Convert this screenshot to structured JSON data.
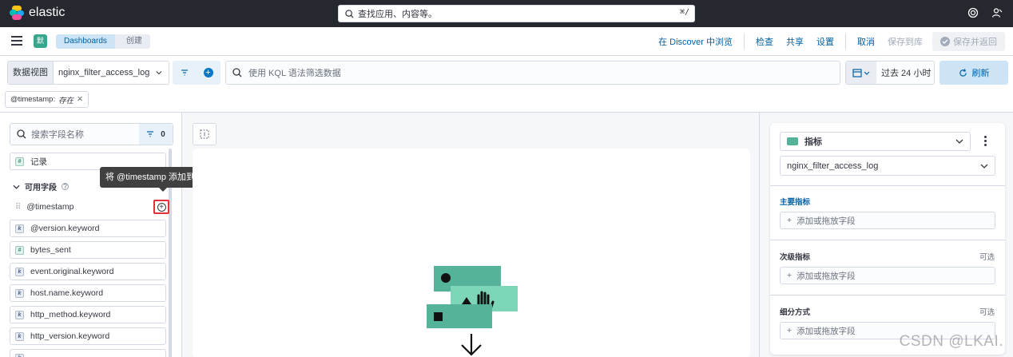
{
  "topbar": {
    "brand": "elastic",
    "search_placeholder": "查找应用、内容等。",
    "search_shortcut": "⌘/",
    "icons": [
      "help-icon",
      "user-icon"
    ]
  },
  "header": {
    "space_initial": "默",
    "breadcrumbs": [
      "Dashboards",
      "创建"
    ],
    "links": [
      "在 Discover 中浏览",
      "检查",
      "共享",
      "设置"
    ],
    "cancel": "取消",
    "save_to_library": "保存到库",
    "save_and_return": "保存并返回"
  },
  "querybar": {
    "dataview_label": "数据视图",
    "dataview_value": "nginx_filter_access_log",
    "kql_placeholder": "使用 KQL 语法筛选数据",
    "time_range": "过去 24 小时",
    "refresh": "刷新"
  },
  "filter_pill": {
    "field": "@timestamp:",
    "value": "存在"
  },
  "sidebar": {
    "search_placeholder": "搜索字段名称",
    "filter_count": "0",
    "records_label": "记录",
    "section_title": "可用字段",
    "tooltip": "将 @timestamp 添加到工作区",
    "fields": [
      {
        "name": "@timestamp",
        "type": "date"
      },
      {
        "name": "@version.keyword",
        "type": "k"
      },
      {
        "name": "bytes_sent",
        "type": "#"
      },
      {
        "name": "event.original.keyword",
        "type": "k"
      },
      {
        "name": "host.name.keyword",
        "type": "k"
      },
      {
        "name": "http_method.keyword",
        "type": "k"
      },
      {
        "name": "http_version.keyword",
        "type": "k"
      }
    ]
  },
  "config": {
    "vis_type": "指标",
    "dataview": "nginx_filter_access_log",
    "primary_metric": "主要指标",
    "secondary_metric": "次级指标",
    "breakdown": "细分方式",
    "optional": "可选",
    "drop_hint": "添加或拖放字段"
  },
  "watermark": "CSDN @LKAI."
}
